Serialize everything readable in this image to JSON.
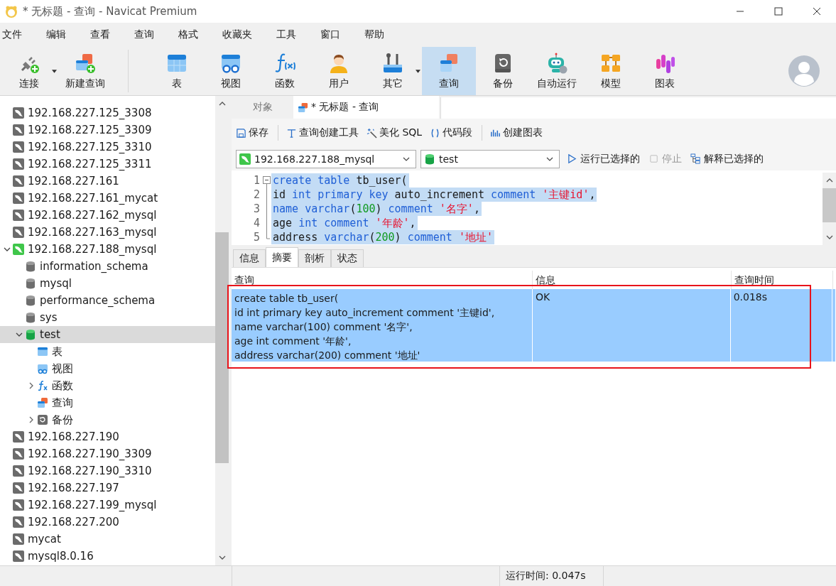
{
  "window": {
    "title": "* 无标题 - 查询 - Navicat Premium"
  },
  "menu": [
    "文件",
    "编辑",
    "查看",
    "查询",
    "格式",
    "收藏夹",
    "工具",
    "窗口",
    "帮助"
  ],
  "toolbar": [
    {
      "label": "连接",
      "kind": "connect",
      "dropdown": true,
      "selected": false,
      "group_end": false
    },
    {
      "label": "新建查询",
      "kind": "newquery",
      "dropdown": false,
      "selected": false,
      "group_end": true
    },
    {
      "label": "表",
      "kind": "table",
      "dropdown": false,
      "selected": false,
      "group_end": false
    },
    {
      "label": "视图",
      "kind": "view",
      "dropdown": false,
      "selected": false,
      "group_end": false
    },
    {
      "label": "函数",
      "kind": "function",
      "dropdown": false,
      "selected": false,
      "group_end": false
    },
    {
      "label": "用户",
      "kind": "user",
      "dropdown": false,
      "selected": false,
      "group_end": false
    },
    {
      "label": "其它",
      "kind": "other",
      "dropdown": true,
      "selected": false,
      "group_end": false
    },
    {
      "label": "查询",
      "kind": "query",
      "dropdown": false,
      "selected": true,
      "group_end": false
    },
    {
      "label": "备份",
      "kind": "backup",
      "dropdown": false,
      "selected": false,
      "group_end": false
    },
    {
      "label": "自动运行",
      "kind": "robot",
      "dropdown": false,
      "selected": false,
      "group_end": false
    },
    {
      "label": "模型",
      "kind": "model",
      "dropdown": false,
      "selected": false,
      "group_end": false
    },
    {
      "label": "图表",
      "kind": "chart",
      "dropdown": false,
      "selected": false,
      "group_end": false
    }
  ],
  "sidebar": {
    "tree": [
      {
        "label": "192.168.227.125_3308",
        "kind": "server",
        "selected": false
      },
      {
        "label": "192.168.227.125_3309",
        "kind": "server",
        "selected": false
      },
      {
        "label": "192.168.227.125_3310",
        "kind": "server",
        "selected": false
      },
      {
        "label": "192.168.227.125_3311",
        "kind": "server",
        "selected": false
      },
      {
        "label": "192.168.227.161",
        "kind": "server",
        "selected": false
      },
      {
        "label": "192.168.227.161_mycat",
        "kind": "server",
        "selected": false
      },
      {
        "label": "192.168.227.162_mysql",
        "kind": "server",
        "selected": false
      },
      {
        "label": "192.168.227.163_mysql",
        "kind": "server",
        "selected": false
      },
      {
        "label": "192.168.227.188_mysql",
        "kind": "server-open",
        "selected": false,
        "expanded": true,
        "children": [
          {
            "label": "information_schema",
            "kind": "database",
            "selected": false
          },
          {
            "label": "mysql",
            "kind": "database",
            "selected": false
          },
          {
            "label": "performance_schema",
            "kind": "database",
            "selected": false
          },
          {
            "label": "sys",
            "kind": "database",
            "selected": false
          },
          {
            "label": "test",
            "kind": "database-open",
            "selected": true,
            "expanded": true,
            "children": [
              {
                "label": "表",
                "kind": "tables",
                "selected": false
              },
              {
                "label": "视图",
                "kind": "views",
                "selected": false
              },
              {
                "label": "函数",
                "kind": "functions",
                "selected": false,
                "expanded": false
              },
              {
                "label": "查询",
                "kind": "queries",
                "selected": false
              },
              {
                "label": "备份",
                "kind": "backups",
                "selected": false,
                "expanded": false
              }
            ]
          }
        ]
      },
      {
        "label": "192.168.227.190",
        "kind": "server",
        "selected": false
      },
      {
        "label": "192.168.227.190_3309",
        "kind": "server",
        "selected": false
      },
      {
        "label": "192.168.227.190_3310",
        "kind": "server",
        "selected": false
      },
      {
        "label": "192.168.227.197",
        "kind": "server",
        "selected": false
      },
      {
        "label": "192.168.227.199_mysql",
        "kind": "server",
        "selected": false
      },
      {
        "label": "192.168.227.200",
        "kind": "server",
        "selected": false
      },
      {
        "label": "mycat",
        "kind": "server",
        "selected": false
      },
      {
        "label": "mysql8.0.16",
        "kind": "server",
        "selected": false
      }
    ]
  },
  "tabs": [
    {
      "label": "对象",
      "selected": false
    },
    {
      "label": "* 无标题 - 查询",
      "selected": true
    }
  ],
  "query_toolbar": [
    {
      "label": "保存",
      "kind": "save"
    },
    {
      "label": "查询创建工具",
      "kind": "builder"
    },
    {
      "label": "美化 SQL",
      "kind": "beautify"
    },
    {
      "label": "代码段",
      "kind": "snippet"
    },
    {
      "label": "创建图表",
      "kind": "chart"
    }
  ],
  "connection_select": "192.168.227.188_mysql",
  "database_select": "test",
  "actions": [
    {
      "label": "运行已选择的",
      "kind": "run",
      "disabled": false
    },
    {
      "label": "停止",
      "kind": "stop",
      "disabled": true
    },
    {
      "label": "解释已选择的",
      "kind": "explain",
      "disabled": false
    }
  ],
  "editor": {
    "lines": [
      {
        "number": "1",
        "selected": true,
        "fold_start": true,
        "fold_end": false,
        "tokens": [
          {
            "kind": "kw",
            "text": "create table"
          },
          {
            "kind": "plain",
            "text": " tb_user("
          }
        ]
      },
      {
        "number": "2",
        "selected": true,
        "fold_start": false,
        "fold_end": false,
        "tokens": [
          {
            "kind": "plain",
            "text": "id "
          },
          {
            "kind": "kw",
            "text": "int primary key"
          },
          {
            "kind": "plain",
            "text": " auto_increment "
          },
          {
            "kind": "kw",
            "text": "comment "
          },
          {
            "kind": "str",
            "text": "'主键id'"
          },
          {
            "kind": "plain",
            "text": ","
          }
        ]
      },
      {
        "number": "3",
        "selected": true,
        "fold_start": false,
        "fold_end": false,
        "tokens": [
          {
            "kind": "kw",
            "text": "name varchar"
          },
          {
            "kind": "plain",
            "text": "("
          },
          {
            "kind": "num",
            "text": "100"
          },
          {
            "kind": "plain",
            "text": ") "
          },
          {
            "kind": "kw",
            "text": "comment "
          },
          {
            "kind": "str",
            "text": "'名字'"
          },
          {
            "kind": "plain",
            "text": ","
          }
        ]
      },
      {
        "number": "4",
        "selected": true,
        "fold_start": false,
        "fold_end": false,
        "tokens": [
          {
            "kind": "plain",
            "text": "age "
          },
          {
            "kind": "kw",
            "text": "int comment "
          },
          {
            "kind": "str",
            "text": "'年龄'"
          },
          {
            "kind": "plain",
            "text": ","
          }
        ]
      },
      {
        "number": "5",
        "selected": true,
        "fold_start": false,
        "fold_end": true,
        "tokens": [
          {
            "kind": "plain",
            "text": "address "
          },
          {
            "kind": "kw",
            "text": "varchar"
          },
          {
            "kind": "plain",
            "text": "("
          },
          {
            "kind": "num",
            "text": "200"
          },
          {
            "kind": "plain",
            "text": ") "
          },
          {
            "kind": "kw",
            "text": "comment "
          },
          {
            "kind": "str",
            "text": "'地址'"
          }
        ]
      }
    ]
  },
  "result_tabs": [
    {
      "label": "信息",
      "selected": false
    },
    {
      "label": "摘要",
      "selected": true
    },
    {
      "label": "剖析",
      "selected": false
    },
    {
      "label": "状态",
      "selected": false
    }
  ],
  "result": {
    "columns": [
      "查询",
      "信息",
      "查询时间"
    ],
    "highlight_frame": true,
    "rows": [
      {
        "selected": true,
        "query": [
          "create table tb_user(",
          "id int primary key auto_increment comment '主键id',",
          "name varchar(100) comment '名字',",
          "age int comment '年龄',",
          "address varchar(200) comment '地址'"
        ],
        "info": "OK",
        "time": "0.018s"
      }
    ]
  },
  "status_bar": {
    "run_time": "运行时间: 0.047s"
  }
}
